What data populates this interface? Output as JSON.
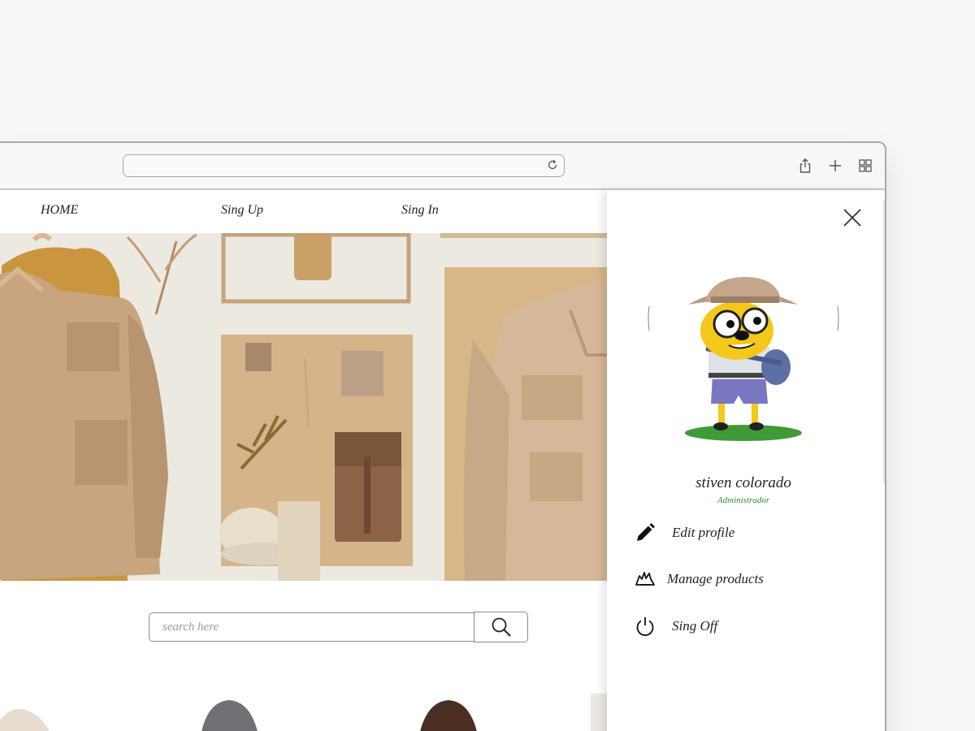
{
  "browser": {
    "address": "",
    "icons": [
      "reload-icon",
      "share-icon",
      "new-tab-icon",
      "tab-overview-icon"
    ]
  },
  "nav": {
    "links": [
      "HOME",
      "Sing Up",
      "Sing In"
    ]
  },
  "hero": {
    "image": "clothing-flatlay"
  },
  "search": {
    "placeholder": "search here",
    "value": "",
    "button_icon": "search-icon"
  },
  "products": {
    "images": [
      "beige-hoodie",
      "gray-hoodie",
      "brown-hoodie"
    ]
  },
  "side_panel": {
    "close_icon": "close-icon",
    "avatar": "cartoon-explorer-dog",
    "user_name": "stiven colorado",
    "user_role": "Administrador",
    "menu": [
      {
        "label": "Edit profile",
        "icon": "pencil-icon"
      },
      {
        "label": "Manage products",
        "icon": "hands-icon"
      },
      {
        "label": "Sing Off",
        "icon": "power-icon"
      }
    ]
  },
  "colors": {
    "page_bg": "#f6f7f9",
    "role_text": "#2e8b2e",
    "hero_bg": "#ece9e1",
    "tan": "#c7a47c",
    "mustard": "#c9963f"
  }
}
